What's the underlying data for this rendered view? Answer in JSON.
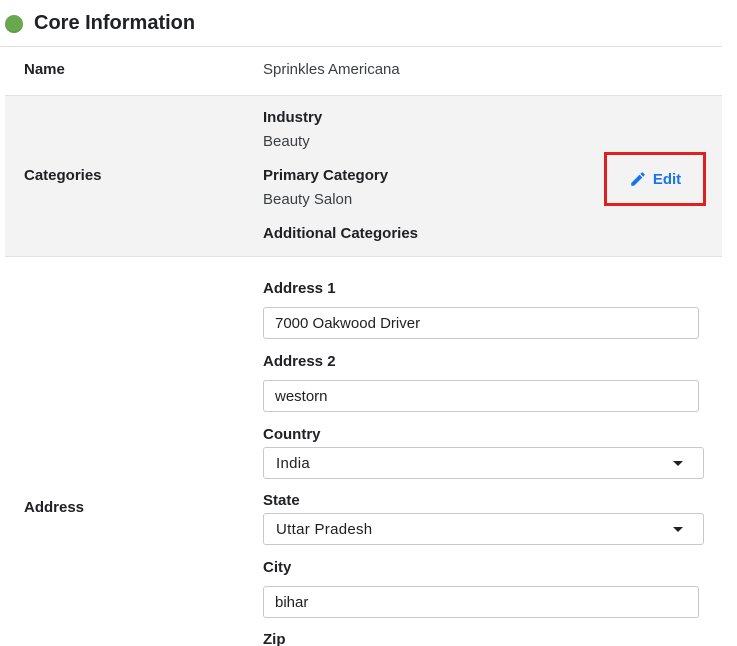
{
  "header": {
    "title": "Core Information",
    "status_color": "#6aa84f"
  },
  "name_row": {
    "label": "Name",
    "value": "Sprinkles Americana"
  },
  "categories_row": {
    "label": "Categories",
    "industry_label": "Industry",
    "industry_value": "Beauty",
    "primary_label": "Primary Category",
    "primary_value": "Beauty Salon",
    "additional_label": "Additional Categories",
    "edit_label": "Edit",
    "edit_icon": "pencil-icon",
    "highlight_color": "#e0201e",
    "accent_color": "#1a73e8"
  },
  "address_row": {
    "label": "Address",
    "address1_label": "Address 1",
    "address1_value": "7000 Oakwood Driver",
    "address2_label": "Address 2",
    "address2_value": "westorn",
    "country_label": "Country",
    "country_value": "India",
    "state_label": "State",
    "state_value": "Uttar Pradesh",
    "city_label": "City",
    "city_value": "bihar",
    "zip_label": "Zip"
  }
}
